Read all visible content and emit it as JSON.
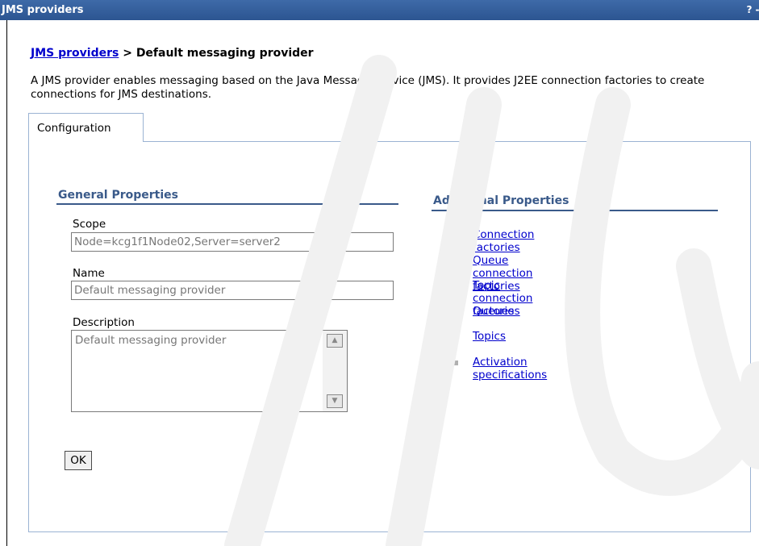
{
  "window": {
    "title": "JMS providers",
    "help_glyph": "?",
    "min_glyph": "-"
  },
  "breadcrumb": {
    "link": "JMS providers",
    "separator": " > ",
    "current": "Default messaging provider"
  },
  "description": "A JMS provider enables messaging based on the Java Message Service (JMS). It provides J2EE connection factories to create connections for JMS destinations.",
  "tabs": [
    {
      "label": "Configuration",
      "active": true
    }
  ],
  "general_properties": {
    "heading": "General Properties",
    "scope": {
      "label": "Scope",
      "value": "Node=kcg1f1Node02,Server=server2"
    },
    "name": {
      "label": "Name",
      "value": "Default messaging provider"
    },
    "description": {
      "label": "Description",
      "value": "Default messaging provider"
    },
    "ok_label": "OK"
  },
  "additional_properties": {
    "heading": "Additional Properties",
    "items": [
      "Connection factories",
      "Queue connection factories",
      "Topic connection factories",
      "Queues",
      "Topics",
      "Activation specifications"
    ]
  },
  "colors": {
    "title_bar": "#2c5591",
    "link": "#0000cc",
    "section_heading": "#3a5a8a",
    "tab_border": "#9bb3d3"
  }
}
